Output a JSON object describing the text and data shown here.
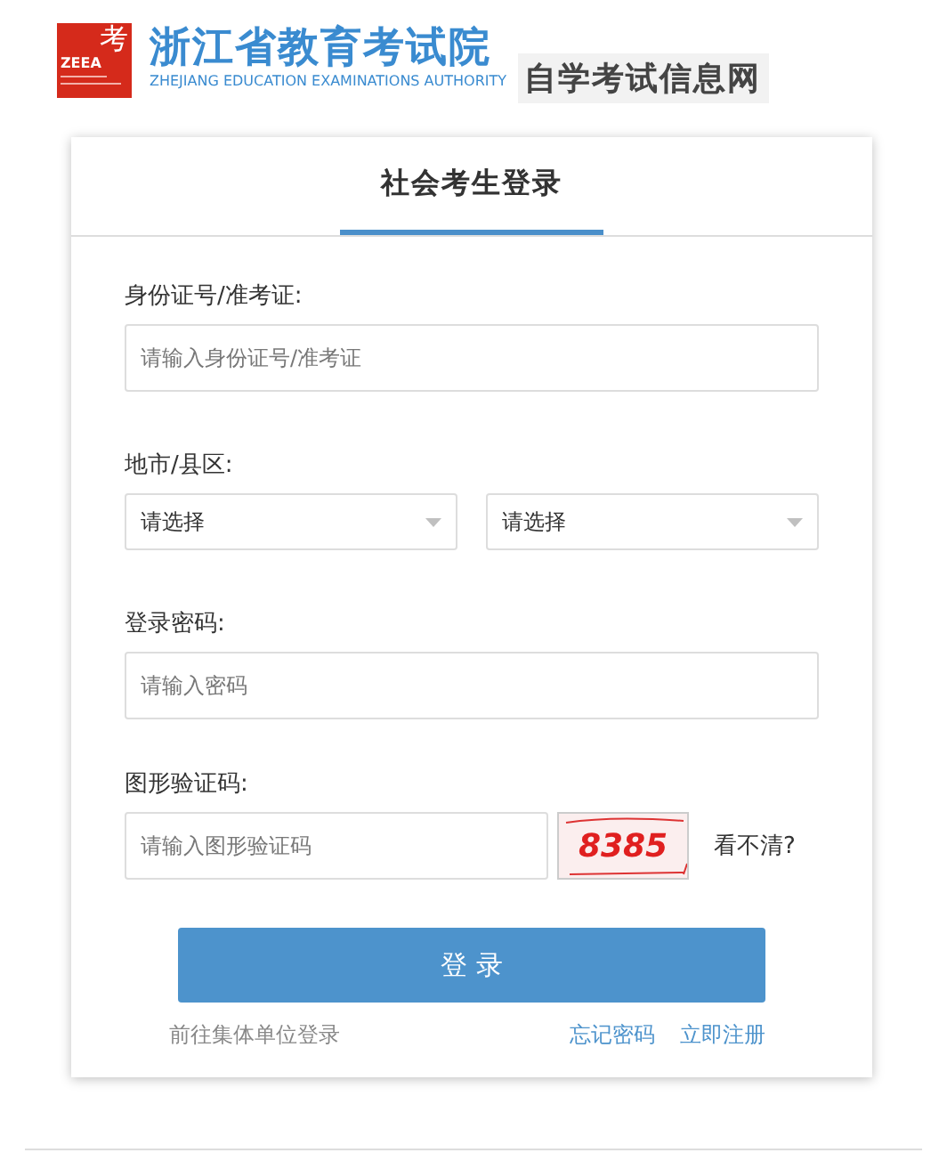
{
  "header": {
    "logo_glyph": "考",
    "logo_abbr": "ZEEA",
    "org_name": "浙江省教育考试院",
    "org_name_en": "ZHEJIANG EDUCATION EXAMINATIONS AUTHORITY",
    "site_name": "自学考试信息网"
  },
  "tabs": [
    {
      "label": "社会考生登录",
      "selected": true
    }
  ],
  "form": {
    "fields": [
      {
        "kind": "text",
        "label": "身份证号/准考证:",
        "placeholder": "请输入身份证号/准考证"
      },
      {
        "kind": "selects",
        "label": "地市/县区:",
        "selects": [
          "请选择",
          "请选择"
        ]
      },
      {
        "kind": "text",
        "label": "登录密码:",
        "placeholder": "请输入密码"
      },
      {
        "kind": "captcha",
        "label": "图形验证码:",
        "placeholder": "请输入图形验证码",
        "captcha": "8385",
        "refresh": "看不清?"
      }
    ],
    "submit": "登 录",
    "links_left": [
      "前往集体单位登录"
    ],
    "links_right": [
      "忘记密码",
      "立即注册"
    ]
  }
}
